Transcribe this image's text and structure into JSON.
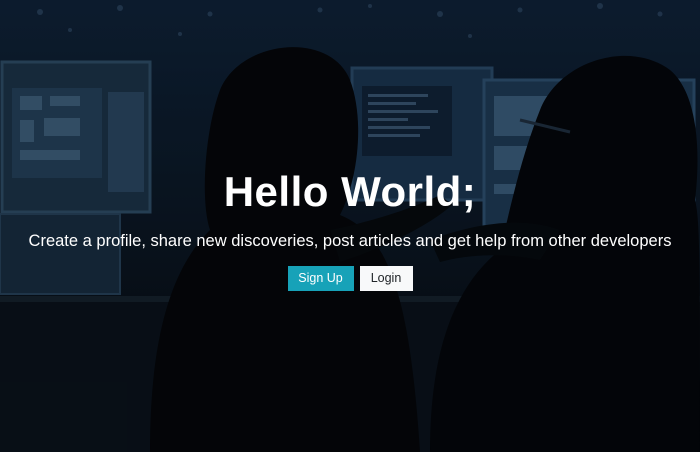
{
  "hero": {
    "title": "Hello World;",
    "subtitle": "Create a profile, share new discoveries, post articles and get help from other developers"
  },
  "buttons": {
    "signup_label": "Sign Up",
    "login_label": "Login"
  },
  "colors": {
    "signup_bg": "#17a2b8",
    "login_bg": "#f8f9fa",
    "text": "#ffffff"
  }
}
